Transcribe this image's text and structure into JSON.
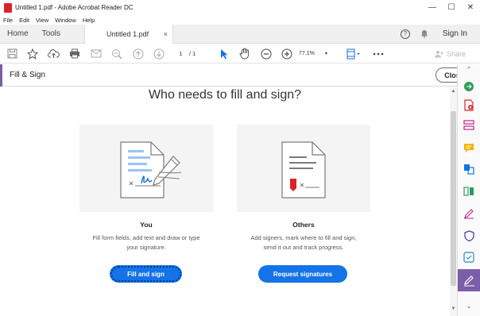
{
  "window": {
    "title": "Untitled 1.pdf - Adobe Acrobat Reader DC",
    "minimize_glyph": "—",
    "maximize_glyph": "☐",
    "close_glyph": "✕"
  },
  "menu": [
    "File",
    "Edit",
    "View",
    "Window",
    "Help"
  ],
  "tabs": {
    "home": "Home",
    "tools": "Tools",
    "document": "Untitled 1.pdf",
    "document_close": "×",
    "help_glyph": "?",
    "sign_in": "Sign In"
  },
  "toolbar": {
    "page_current": "1",
    "page_total": "/ 1",
    "zoom": "77.1%",
    "share": "Share",
    "icons": [
      "save-icon",
      "star-icon",
      "upload-icon",
      "print-icon",
      "email-icon",
      "zoom-out-search-icon",
      "page-up-icon",
      "page-down-icon",
      "select-arrow-icon",
      "hand-icon",
      "zoom-minus-icon",
      "zoom-plus-icon",
      "fit-page-icon",
      "more-icon"
    ]
  },
  "fill_sign": {
    "title": "Fill & Sign",
    "close_label": "Close",
    "accent_color": "#7b5ea7"
  },
  "main": {
    "heading": "Who needs to fill and sign?",
    "cards": [
      {
        "title": "You",
        "description": "Fill form fields, add text and draw or type your signature.",
        "button": "Fill and sign"
      },
      {
        "title": "Others",
        "description": "Add signers, mark where to fill and sign, send it out and track progress.",
        "button": "Request signatures"
      }
    ]
  },
  "scroll": {
    "up": "▲",
    "down": "▼"
  },
  "right_pane": {
    "icons": [
      "export-pdf-icon",
      "create-pdf-icon",
      "edit-pdf-icon",
      "comment-icon",
      "combine-files-icon",
      "organize-pages-icon",
      "fill-sign-pen-icon",
      "protect-shield-icon",
      "optimize-icon",
      "fill-sign-active-icon"
    ],
    "up_glyph": "⌃",
    "down_glyph": "⌄"
  },
  "colors": {
    "primary_button": "#1473e6",
    "acrobat_red": "#d8232a"
  }
}
